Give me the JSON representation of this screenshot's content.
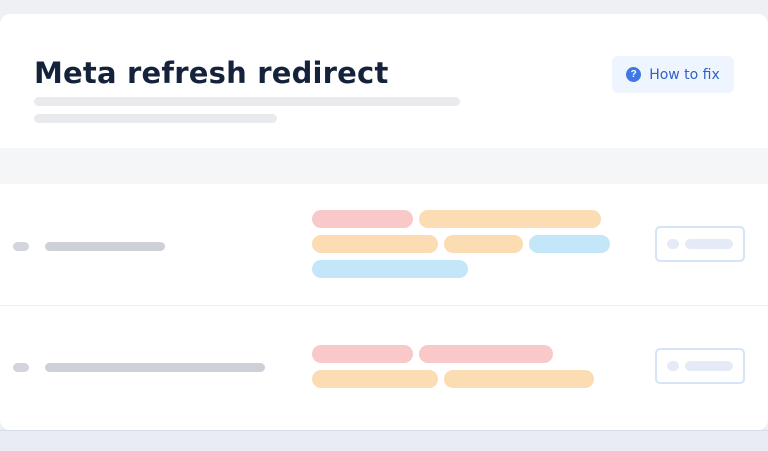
{
  "header": {
    "title": "Meta refresh redirect",
    "how_to_fix_label": "How to fix",
    "help_icon_glyph": "?"
  },
  "colors": {
    "title": "#14233b",
    "accent": "#3f78e6",
    "tag_pink": "#f9c8c8",
    "tag_orange": "#fcdcb2",
    "tag_blue": "#c3e6f8"
  },
  "icons": {
    "help": "question-circle-icon"
  },
  "rows": [
    {
      "tags": [
        "pink",
        "orange",
        "orange",
        "orange",
        "blue",
        "blue"
      ]
    },
    {
      "tags": [
        "pink",
        "pink",
        "orange",
        "orange"
      ]
    }
  ]
}
